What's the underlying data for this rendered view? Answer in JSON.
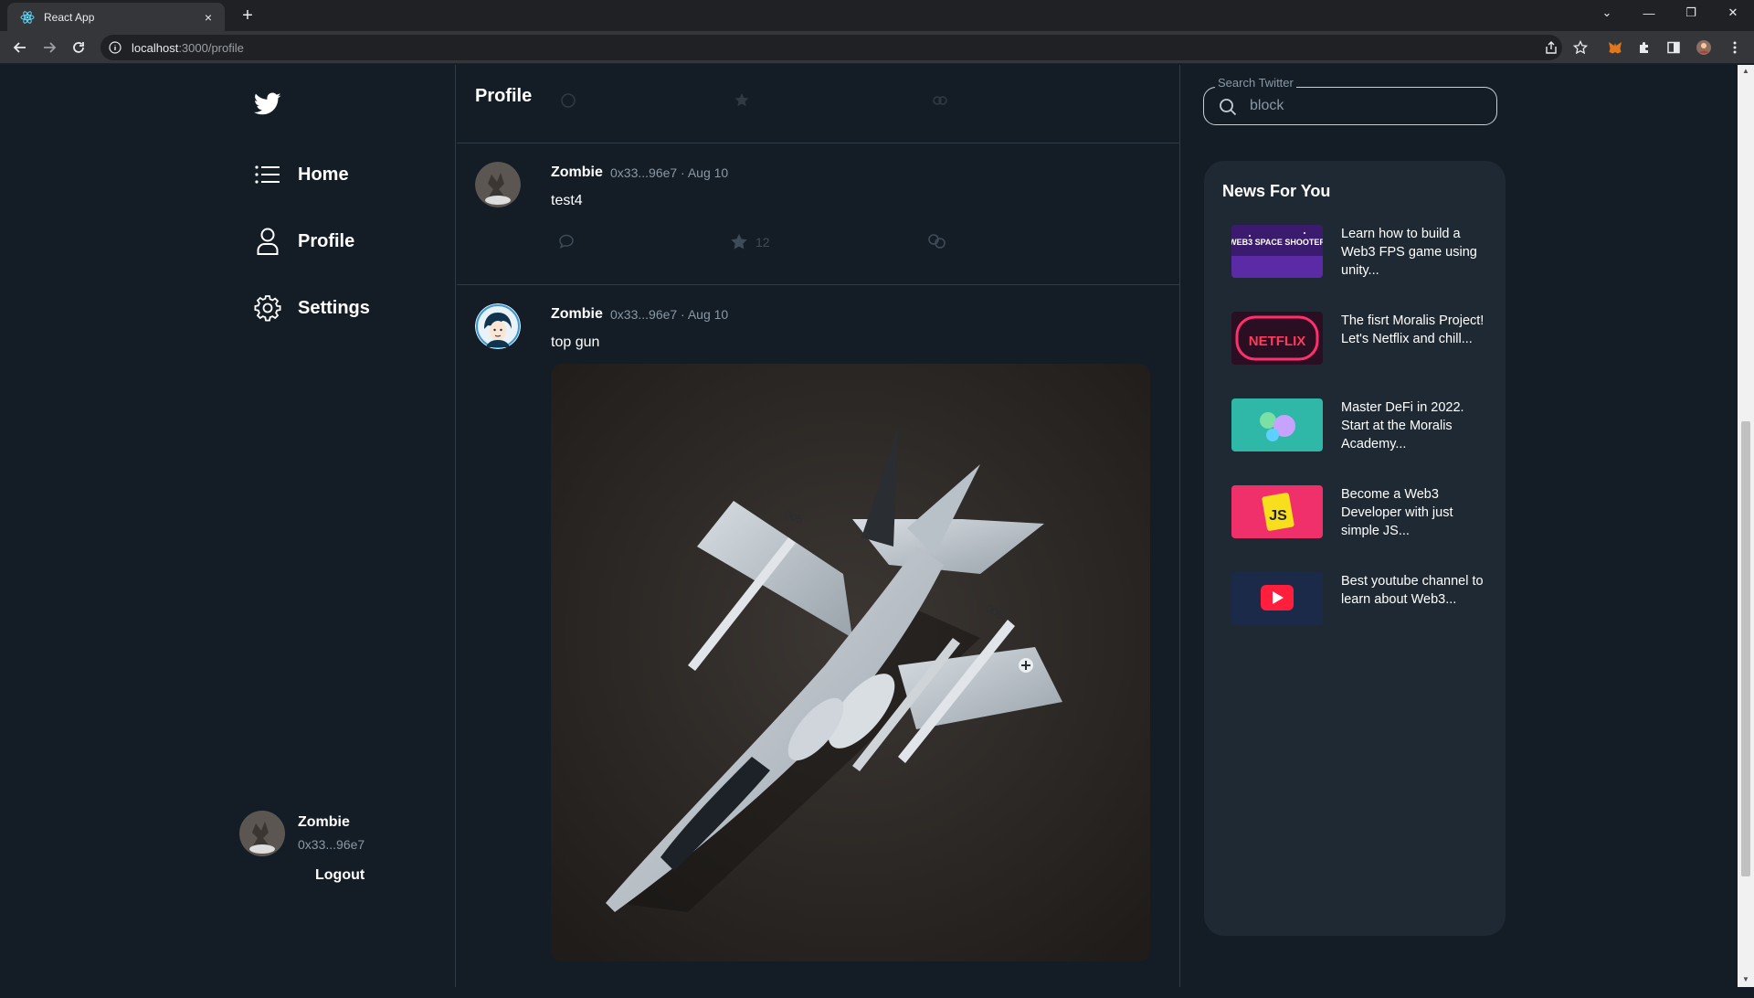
{
  "browser": {
    "tab_title": "React App",
    "tab_close": "×",
    "new_tab": "+",
    "url_host": "localhost",
    "url_path": ":3000/profile",
    "window_controls": [
      "⌄",
      "—",
      "❐",
      "✕"
    ]
  },
  "sidebar": {
    "items": [
      {
        "label": "Home",
        "icon": "list-icon"
      },
      {
        "label": "Profile",
        "icon": "user-icon"
      },
      {
        "label": "Settings",
        "icon": "gear-icon"
      }
    ],
    "user": {
      "name": "Zombie",
      "address": "0x33...96e7"
    },
    "logout_label": "Logout"
  },
  "feed": {
    "title": "Profile",
    "posts": [
      {
        "author": "Zombie",
        "meta": "0x33...96e7 · Aug 10",
        "text": "test4",
        "like_count": "12"
      },
      {
        "author": "Zombie",
        "meta": "0x33...96e7 · Aug 10",
        "text": "top gun",
        "image_alt": "F/A-18 model jet photo"
      }
    ]
  },
  "search": {
    "legend": "Search Twitter",
    "value": "block"
  },
  "news": {
    "title": "News For You",
    "items": [
      {
        "text": "Learn how to build a Web3 FPS game using unity...",
        "thumb_label": "WEB3 SPACE SHOOTER",
        "thumb_color": "#3b1b6e"
      },
      {
        "text": "The fisrt Moralis Project! Let's Netflix and chill...",
        "thumb_label": "NETFLIX",
        "thumb_color": "#d81f5c"
      },
      {
        "text": "Master DeFi in 2022. Start at the Moralis Academy...",
        "thumb_label": "",
        "thumb_color": "#2fb7a8"
      },
      {
        "text": "Become a Web3 Developer with just simple JS...",
        "thumb_label": "JS",
        "thumb_color": "#f0306a"
      },
      {
        "text": "Best youtube channel to learn about Web3...",
        "thumb_label": "",
        "thumb_color": "#1c2a4a"
      }
    ]
  },
  "colors": {
    "background": "#141d26",
    "panel": "#1f2933",
    "border": "#2f3b46",
    "muted_text": "#8a98a5"
  }
}
